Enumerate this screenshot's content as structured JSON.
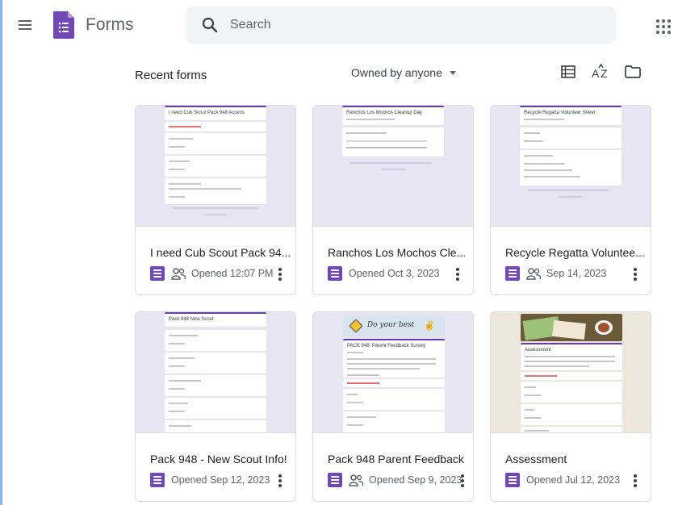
{
  "app": {
    "title": "Forms"
  },
  "search": {
    "placeholder": "Search",
    "value": ""
  },
  "toolbar": {
    "section_title": "Recent forms",
    "owner_filter": "Owned by anyone",
    "list_view_icon": "list-view-icon",
    "sort_icon": "sort-az-icon",
    "folder_icon": "folder-icon"
  },
  "colors": {
    "accent": "#673ab7",
    "form_icon": "#7248b9",
    "thumbnail_bg": "#e8e5f2"
  },
  "forms": [
    {
      "title": "I need Cub Scout Pack 94...",
      "meta": "Opened 12:07 PM",
      "shared": true,
      "thumb_header": "I need Cub Scout Pack 948 Access"
    },
    {
      "title": "Ranchos Los Mochos Cle...",
      "meta": "Opened Oct 3, 2023",
      "shared": false,
      "thumb_header": "Ranchos Los Mochos Cleanup Day"
    },
    {
      "title": "Recycle Regatta Voluntee...",
      "meta": "Sep 14, 2023",
      "shared": true,
      "thumb_header": "Recycle Regatta Volunteer Sheet"
    },
    {
      "title": "Pack 948 - New Scout Info!",
      "meta": "Opened Sep 12, 2023",
      "shared": false,
      "thumb_header": "Pack 948 New Scout"
    },
    {
      "title": "Pack 948 Parent Feedback",
      "meta": "Opened Sep 9, 2023",
      "shared": true,
      "thumb_header": "PACK 948: Parent Feedback Survey",
      "banner_text": "Do your best"
    },
    {
      "title": "Assessment",
      "meta": "Opened Jul 12, 2023",
      "shared": false,
      "thumb_header": "Assessment"
    }
  ]
}
